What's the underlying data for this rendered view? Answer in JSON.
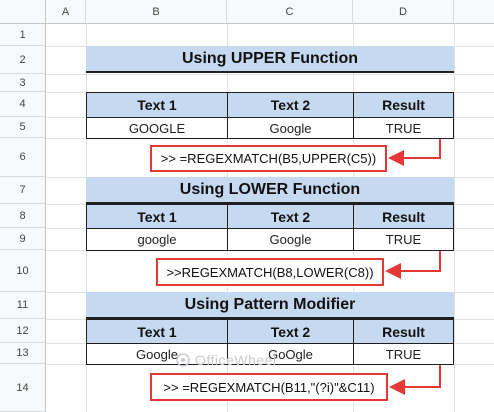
{
  "columns": [
    "A",
    "B",
    "C",
    "D"
  ],
  "rows": [
    "1",
    "2",
    "3",
    "4",
    "5",
    "6",
    "7",
    "8",
    "9",
    "10",
    "11",
    "12",
    "13",
    "14"
  ],
  "sections": [
    {
      "title": "Using UPPER Function",
      "headers": [
        "Text 1",
        "Text 2",
        "Result"
      ],
      "values": [
        "GOOGLE",
        "Google",
        "TRUE"
      ],
      "formula": ">> =REGEXMATCH(B5,UPPER(C5))"
    },
    {
      "title": "Using LOWER Function",
      "headers": [
        "Text 1",
        "Text 2",
        "Result"
      ],
      "values": [
        "google",
        "Google",
        "TRUE"
      ],
      "formula": ">>REGEXMATCH(B8,LOWER(C8))"
    },
    {
      "title": "Using Pattern Modifier",
      "headers": [
        "Text 1",
        "Text 2",
        "Result"
      ],
      "values": [
        "Google",
        "GoOgle",
        "TRUE"
      ],
      "formula": ">> =REGEXMATCH(B11,\"(?i)\"&C11)"
    }
  ],
  "watermark": "OfficeWheel",
  "colors": {
    "header_fill": "#c5d9f1",
    "arrow": "#e53935",
    "border": "#1f1f1f"
  }
}
